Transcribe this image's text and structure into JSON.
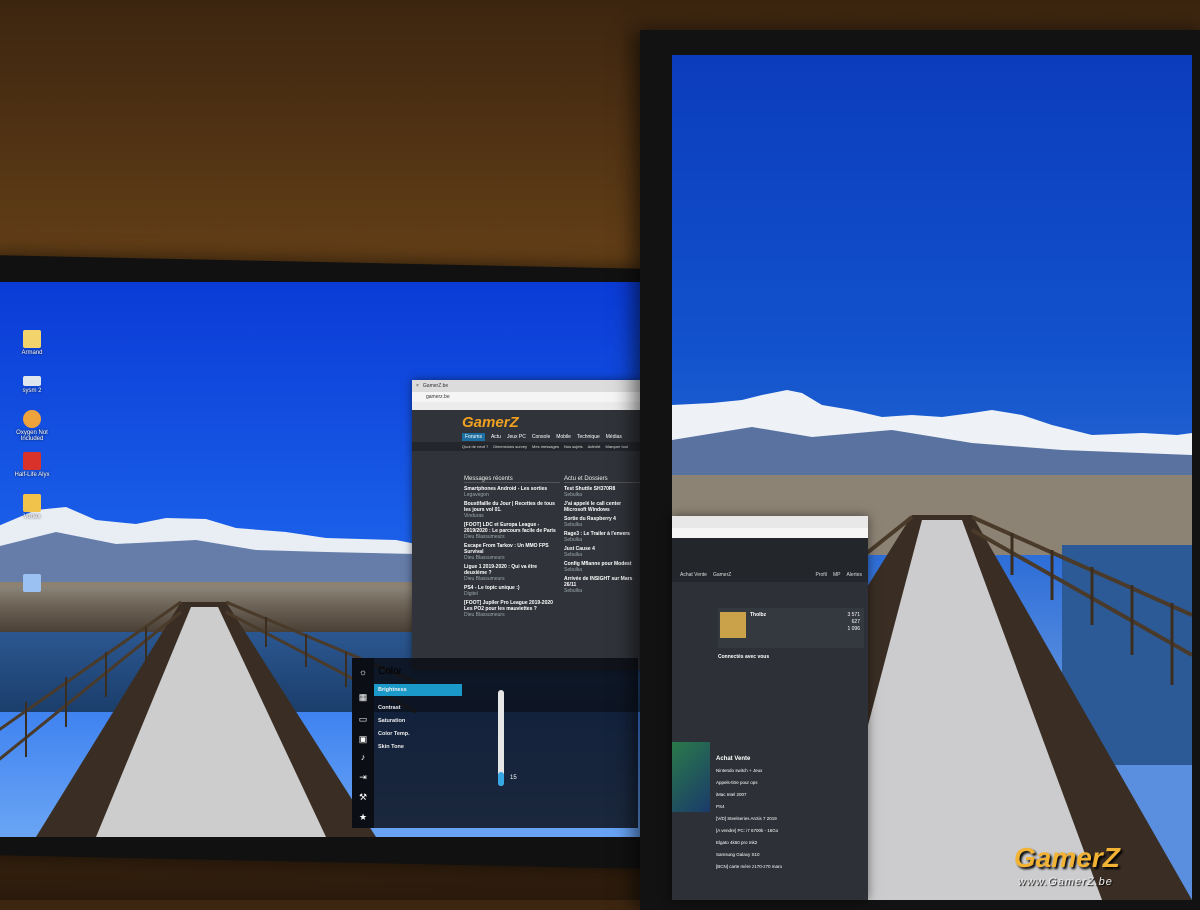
{
  "desktop_icons": [
    {
      "label": "Armand",
      "icon": "folder-icon",
      "color": "#f3d36b"
    },
    {
      "label": "sysm 2",
      "icon": "drive-icon",
      "color": "#dfe6ee"
    },
    {
      "label": "Oxygen Not Included",
      "icon": "game-icon",
      "color": "#f0a33a"
    },
    {
      "label": "Half-Life Alyx",
      "icon": "halflife-icon",
      "color": "#d8322b"
    },
    {
      "label": "Vortex",
      "icon": "app-icon",
      "color": "#f1c34a"
    },
    {
      "label": "",
      "icon": "file-icon",
      "color": "#9bc1f2"
    }
  ],
  "browser_left": {
    "tab_title": "GamerZ.be",
    "url": "gamerz.be",
    "logo": "GamerZ",
    "nav": [
      "Forums",
      "Actu",
      "Jeux PC",
      "Console",
      "Mobile",
      "Technique",
      "Médias"
    ],
    "subnav": [
      "Quoi de neuf ?",
      "Dimensions survey",
      "Mes messages",
      "Nos sujets",
      "Activité",
      "Marquer tout"
    ],
    "col1_title": "Messages récents",
    "col1_items": [
      {
        "title": "Smartphones Android - Les sorties",
        "meta": "Legavegon"
      },
      {
        "title": "Boustifaille du Jour | Recettes de tous les jours vol 01.",
        "meta": "Vinduras"
      },
      {
        "title": "[FOOT] LDC et Europa League - 2019/2020 : Le parcours facile de Paris",
        "meta": "Dieu Blassumeurs"
      },
      {
        "title": "Escape From Tarkov : Un MMO FPS Survival",
        "meta": "Dieu Blassumeurs"
      },
      {
        "title": "Ligue 1 2019-2020 : Qui va être deuxième ?",
        "meta": "Dieu Blassumeurs"
      },
      {
        "title": "PS4 - Le topic unique :)",
        "meta": "Digitel"
      },
      {
        "title": "[FOOT] Jupiler Pro League 2019-2020 Les PO2 pour les mauviettes ?",
        "meta": "Dieu Blassumeurs"
      }
    ],
    "col2_title": "Actu et Dossiers",
    "col2_items": [
      {
        "title": "Test Shuttle SH370R8",
        "meta": "Sebulka"
      },
      {
        "title": "J'ai appelé le call center Microsoft Windows",
        "meta": ""
      },
      {
        "title": "Sortie du Raspberry 4",
        "meta": "Sebulka"
      },
      {
        "title": "Rage3 : Le Trailer à l'envers",
        "meta": "Sebulka"
      },
      {
        "title": "Just Cause 4",
        "meta": "Sebulka"
      },
      {
        "title": "Config Mflanne pour Modest",
        "meta": "Sebulka"
      },
      {
        "title": "Arrivée de INSIGHT sur Mars 26/11",
        "meta": "Sebulka"
      }
    ]
  },
  "osd": {
    "title": "Color",
    "items": [
      "Brightness",
      "Contrast",
      "Saturation",
      "Color Temp.",
      "Skin Tone"
    ],
    "value": "15",
    "value_fraction": 0.15
  },
  "browser_right": {
    "nav": [
      "Achat Vente",
      "GamerZ"
    ],
    "right_links": [
      "Profil",
      "MP",
      "Alertes"
    ],
    "user": "Tholbz",
    "stats": [
      "3 571",
      "627",
      "1 096"
    ],
    "connected_title": "Connectés avec vous",
    "list_title": "Achat Vente",
    "list_items": [
      "Nintendo switch + Jeux",
      "Appels-titre pour ops",
      "iMac Intel 2007",
      "PS4",
      "[V/D] Steelseries Arctis 7 2019",
      "[A vendre] PC: i7 6700k - 16Go",
      "Elgato 4k60 pro mk2",
      "Samsung Galaxy S10",
      "[BCN] carte mère z170-z70 maro"
    ]
  },
  "watermark": {
    "logo": "GamerZ",
    "url": "www.GamerZ.be",
    "color": "#f2b233"
  }
}
